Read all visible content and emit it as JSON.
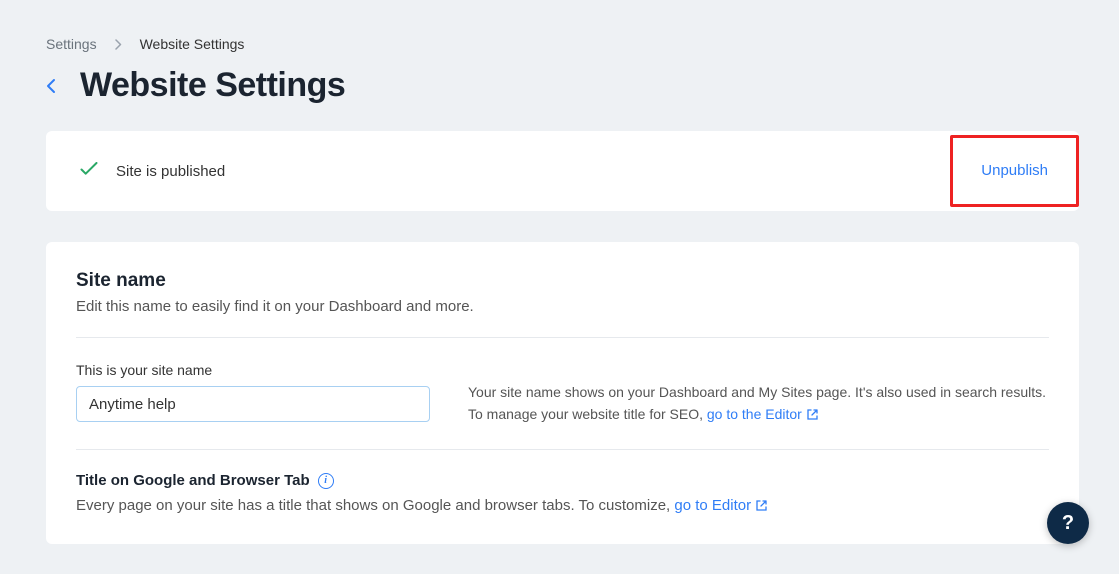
{
  "breadcrumb": {
    "root": "Settings",
    "current": "Website Settings"
  },
  "page_title": "Website Settings",
  "status": {
    "text": "Site is published",
    "action": "Unpublish"
  },
  "site_name_section": {
    "title": "Site name",
    "desc": "Edit this name to easily find it on your Dashboard and more.",
    "field_label": "This is your site name",
    "value": "Anytime help",
    "help_prefix": "Your site name shows on your Dashboard and My Sites page. It's also used in search results. To manage your website title for SEO, ",
    "help_link": "go to the Editor"
  },
  "title_tab_section": {
    "title": "Title on Google and Browser Tab",
    "desc_prefix": "Every page on your site has a title that shows on Google and browser tabs. To customize, ",
    "link": "go to Editor"
  },
  "help_label": "?"
}
